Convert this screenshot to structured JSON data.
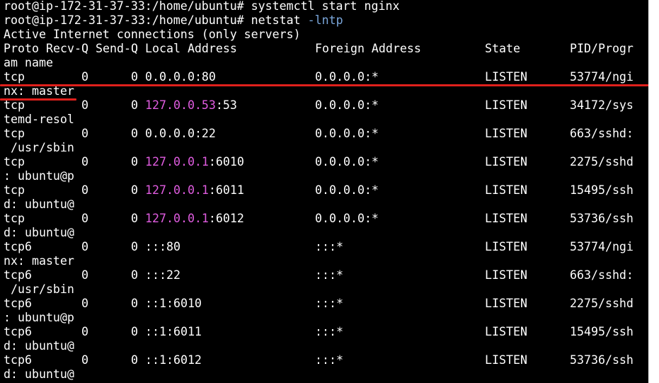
{
  "terminal": {
    "prompt": "root@ip-172-31-37-33:/home/ubuntu#",
    "commands": [
      {
        "text": "systemctl start nginx",
        "arg": ""
      },
      {
        "text": "netstat",
        "arg": "-lntp"
      }
    ],
    "info_line": "Active Internet connections (only servers)",
    "header": {
      "proto": "Proto",
      "recvq": "Recv-Q",
      "sendq": "Send-Q",
      "local": "Local Address",
      "foreign": "Foreign Address",
      "state": "State",
      "pid": "PID/Progr",
      "wrap": "am name"
    },
    "rows": [
      {
        "proto": "tcp",
        "recvq": "0",
        "sendq": "0",
        "local_ip": "0.0.0.0",
        "local_port": ":80",
        "local_hl": false,
        "foreign": "0.0.0.0:*",
        "state": "LISTEN",
        "pid": "53774/ngi",
        "wrap": "nx: master"
      },
      {
        "proto": "tcp",
        "recvq": "0",
        "sendq": "0",
        "local_ip": "127.0.0.53",
        "local_port": ":53",
        "local_hl": true,
        "foreign": "0.0.0.0:*",
        "state": "LISTEN",
        "pid": "34172/sys",
        "wrap": "temd-resol"
      },
      {
        "proto": "tcp",
        "recvq": "0",
        "sendq": "0",
        "local_ip": "0.0.0.0",
        "local_port": ":22",
        "local_hl": false,
        "foreign": "0.0.0.0:*",
        "state": "LISTEN",
        "pid": "663/sshd:",
        "wrap": " /usr/sbin"
      },
      {
        "proto": "tcp",
        "recvq": "0",
        "sendq": "0",
        "local_ip": "127.0.0.1",
        "local_port": ":6010",
        "local_hl": true,
        "foreign": "0.0.0.0:*",
        "state": "LISTEN",
        "pid": "2275/sshd",
        "wrap": ": ubuntu@p"
      },
      {
        "proto": "tcp",
        "recvq": "0",
        "sendq": "0",
        "local_ip": "127.0.0.1",
        "local_port": ":6011",
        "local_hl": true,
        "foreign": "0.0.0.0:*",
        "state": "LISTEN",
        "pid": "15495/ssh",
        "wrap": "d: ubuntu@"
      },
      {
        "proto": "tcp",
        "recvq": "0",
        "sendq": "0",
        "local_ip": "127.0.0.1",
        "local_port": ":6012",
        "local_hl": true,
        "foreign": "0.0.0.0:*",
        "state": "LISTEN",
        "pid": "53736/ssh",
        "wrap": "d: ubuntu@"
      },
      {
        "proto": "tcp6",
        "recvq": "0",
        "sendq": "0",
        "local_ip": "",
        "local_port": ":::80",
        "local_hl": false,
        "foreign": ":::*",
        "state": "LISTEN",
        "pid": "53774/ngi",
        "wrap": "nx: master"
      },
      {
        "proto": "tcp6",
        "recvq": "0",
        "sendq": "0",
        "local_ip": "",
        "local_port": ":::22",
        "local_hl": false,
        "foreign": ":::*",
        "state": "LISTEN",
        "pid": "663/sshd:",
        "wrap": " /usr/sbin"
      },
      {
        "proto": "tcp6",
        "recvq": "0",
        "sendq": "0",
        "local_ip": "",
        "local_port": "::1:6010",
        "local_hl": false,
        "foreign": ":::*",
        "state": "LISTEN",
        "pid": "2275/sshd",
        "wrap": ": ubuntu@p"
      },
      {
        "proto": "tcp6",
        "recvq": "0",
        "sendq": "0",
        "local_ip": "",
        "local_port": "::1:6011",
        "local_hl": false,
        "foreign": ":::*",
        "state": "LISTEN",
        "pid": "15495/ssh",
        "wrap": "d: ubuntu@"
      },
      {
        "proto": "tcp6",
        "recvq": "0",
        "sendq": "0",
        "local_ip": "",
        "local_port": "::1:6012",
        "local_hl": false,
        "foreign": ":::*",
        "state": "LISTEN",
        "pid": "53736/ssh",
        "wrap": "d: ubuntu@"
      }
    ],
    "colors": {
      "background": "#000000",
      "text": "#ffffff",
      "ip_highlight": "#e05ce0",
      "option_arg": "#7aa6da",
      "annotation_underline": "#e0201c"
    }
  }
}
